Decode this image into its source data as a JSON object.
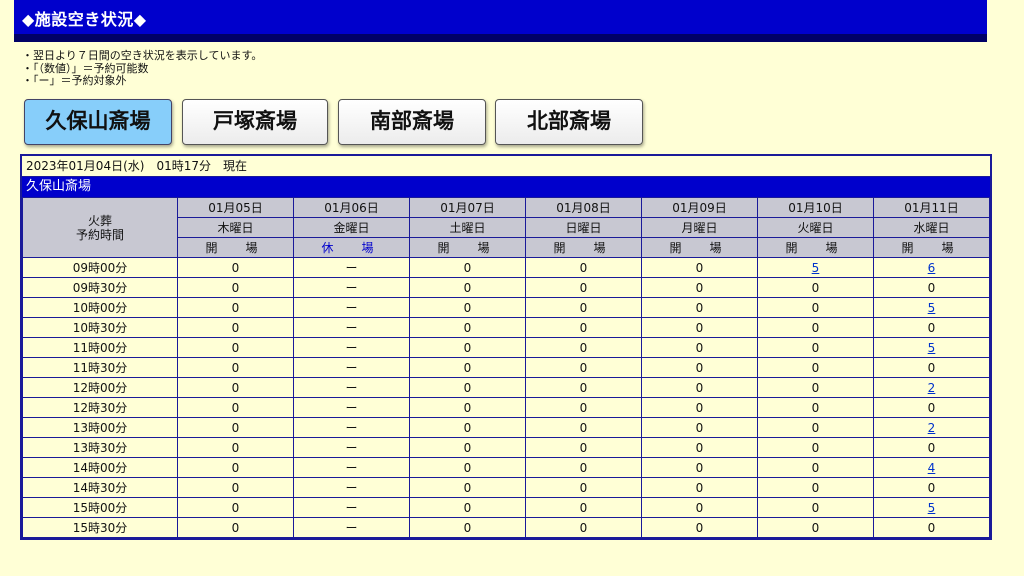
{
  "header": {
    "title": "◆施設空き状況◆"
  },
  "notes": [
    "・翌日より７日間の空き状況を表示しています。",
    "・「（数値）」＝予約可能数",
    "・「ー」＝予約対象外"
  ],
  "tabs": [
    {
      "label": "久保山斎場",
      "active": true
    },
    {
      "label": "戸塚斎場",
      "active": false
    },
    {
      "label": "南部斎場",
      "active": false
    },
    {
      "label": "北部斎場",
      "active": false
    }
  ],
  "table": {
    "datetime": "2023年01月04日(水)　01時17分　現在",
    "venue": "久保山斎場",
    "corner_label_1": "火葬",
    "corner_label_2": "予約時間",
    "days": [
      {
        "date": "01月05日",
        "weekday": "木曜日",
        "status": "開　場",
        "closed": false
      },
      {
        "date": "01月06日",
        "weekday": "金曜日",
        "status": "休　場",
        "closed": true
      },
      {
        "date": "01月07日",
        "weekday": "土曜日",
        "status": "開　場",
        "closed": false
      },
      {
        "date": "01月08日",
        "weekday": "日曜日",
        "status": "開　場",
        "closed": false
      },
      {
        "date": "01月09日",
        "weekday": "月曜日",
        "status": "開　場",
        "closed": false
      },
      {
        "date": "01月10日",
        "weekday": "火曜日",
        "status": "開　場",
        "closed": false
      },
      {
        "date": "01月11日",
        "weekday": "水曜日",
        "status": "開　場",
        "closed": false
      }
    ],
    "rows": [
      {
        "time": "09時00分",
        "cells": [
          "0",
          "ー",
          "0",
          "0",
          "0",
          "5",
          "6"
        ]
      },
      {
        "time": "09時30分",
        "cells": [
          "0",
          "ー",
          "0",
          "0",
          "0",
          "0",
          "0"
        ]
      },
      {
        "time": "10時00分",
        "cells": [
          "0",
          "ー",
          "0",
          "0",
          "0",
          "0",
          "5"
        ]
      },
      {
        "time": "10時30分",
        "cells": [
          "0",
          "ー",
          "0",
          "0",
          "0",
          "0",
          "0"
        ]
      },
      {
        "time": "11時00分",
        "cells": [
          "0",
          "ー",
          "0",
          "0",
          "0",
          "0",
          "5"
        ]
      },
      {
        "time": "11時30分",
        "cells": [
          "0",
          "ー",
          "0",
          "0",
          "0",
          "0",
          "0"
        ]
      },
      {
        "time": "12時00分",
        "cells": [
          "0",
          "ー",
          "0",
          "0",
          "0",
          "0",
          "2"
        ]
      },
      {
        "time": "12時30分",
        "cells": [
          "0",
          "ー",
          "0",
          "0",
          "0",
          "0",
          "0"
        ]
      },
      {
        "time": "13時00分",
        "cells": [
          "0",
          "ー",
          "0",
          "0",
          "0",
          "0",
          "2"
        ]
      },
      {
        "time": "13時30分",
        "cells": [
          "0",
          "ー",
          "0",
          "0",
          "0",
          "0",
          "0"
        ]
      },
      {
        "time": "14時00分",
        "cells": [
          "0",
          "ー",
          "0",
          "0",
          "0",
          "0",
          "4"
        ]
      },
      {
        "time": "14時30分",
        "cells": [
          "0",
          "ー",
          "0",
          "0",
          "0",
          "0",
          "0"
        ]
      },
      {
        "time": "15時00分",
        "cells": [
          "0",
          "ー",
          "0",
          "0",
          "0",
          "0",
          "5"
        ]
      },
      {
        "time": "15時30分",
        "cells": [
          "0",
          "ー",
          "0",
          "0",
          "0",
          "0",
          "0"
        ]
      }
    ]
  }
}
